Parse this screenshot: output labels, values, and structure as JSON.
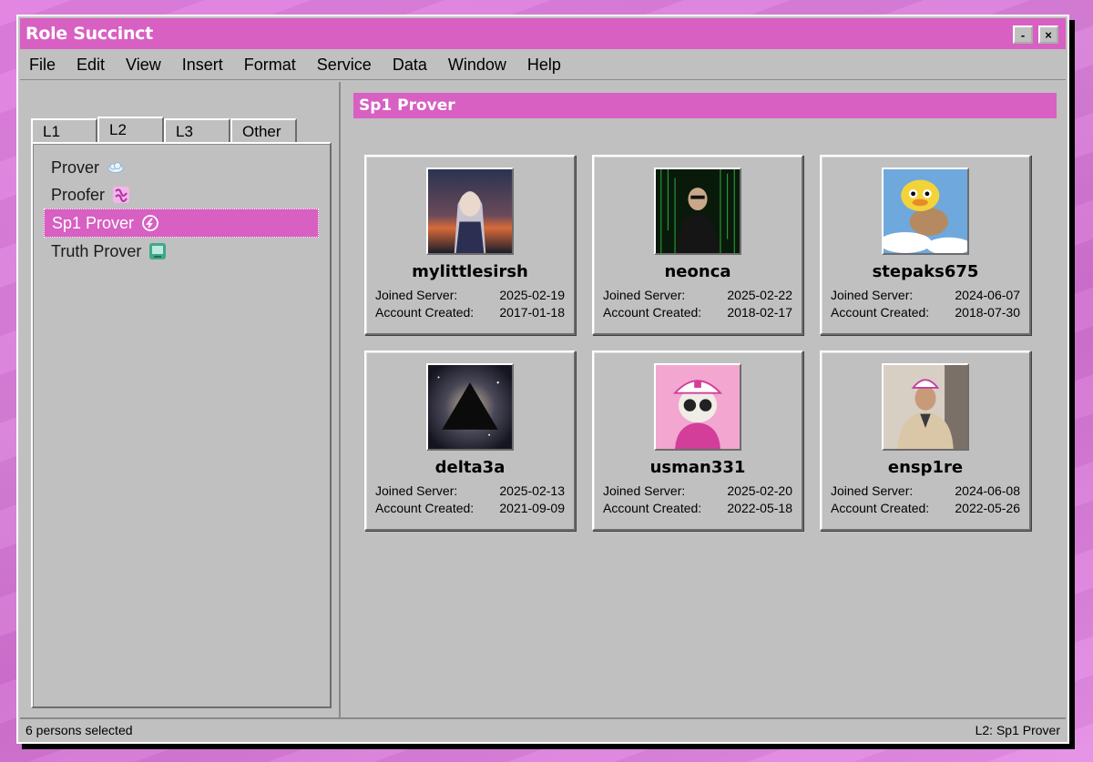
{
  "window": {
    "title": "Role Succinct",
    "minimize_label": "-",
    "close_label": "×"
  },
  "menu": [
    "File",
    "Edit",
    "View",
    "Insert",
    "Format",
    "Service",
    "Data",
    "Window",
    "Help"
  ],
  "tabs": [
    "L1",
    "L2",
    "L3",
    "Other"
  ],
  "active_tab": "L2",
  "tree": [
    {
      "label": "Prover",
      "icon": "cloud-icon"
    },
    {
      "label": "Proofer",
      "icon": "pink-squiggle-icon"
    },
    {
      "label": "Sp1 Prover",
      "icon": "sp1-logo-icon",
      "selected": true
    },
    {
      "label": "Truth Prover",
      "icon": "green-tablet-icon"
    }
  ],
  "panel": {
    "title": "Sp1 Prover"
  },
  "labels": {
    "joined": "Joined Server:",
    "created": "Account Created:"
  },
  "cards": [
    {
      "username": "mylittlesirsh",
      "joined": "2025-02-19",
      "created": "2017-01-18",
      "avatar": "anime-girl-sunset-avatar"
    },
    {
      "username": "neonca",
      "joined": "2025-02-22",
      "created": "2018-02-17",
      "avatar": "matrix-man-avatar"
    },
    {
      "username": "stepaks675",
      "joined": "2024-06-07",
      "created": "2018-07-30",
      "avatar": "flying-cat-duck-avatar"
    },
    {
      "username": "delta3a",
      "joined": "2025-02-13",
      "created": "2021-09-09",
      "avatar": "pyramid-galaxy-avatar"
    },
    {
      "username": "usman331",
      "joined": "2025-02-20",
      "created": "2022-05-18",
      "avatar": "pink-cap-character-avatar"
    },
    {
      "username": "ensp1re",
      "joined": "2024-06-08",
      "created": "2022-05-26",
      "avatar": "man-in-suit-avatar"
    }
  ],
  "status": {
    "left": "6 persons selected",
    "right": "L2: Sp1 Prover"
  },
  "colors": {
    "accent": "#d760c2",
    "window_bg": "#c0c0c0",
    "desktop": "#d77ed8"
  }
}
